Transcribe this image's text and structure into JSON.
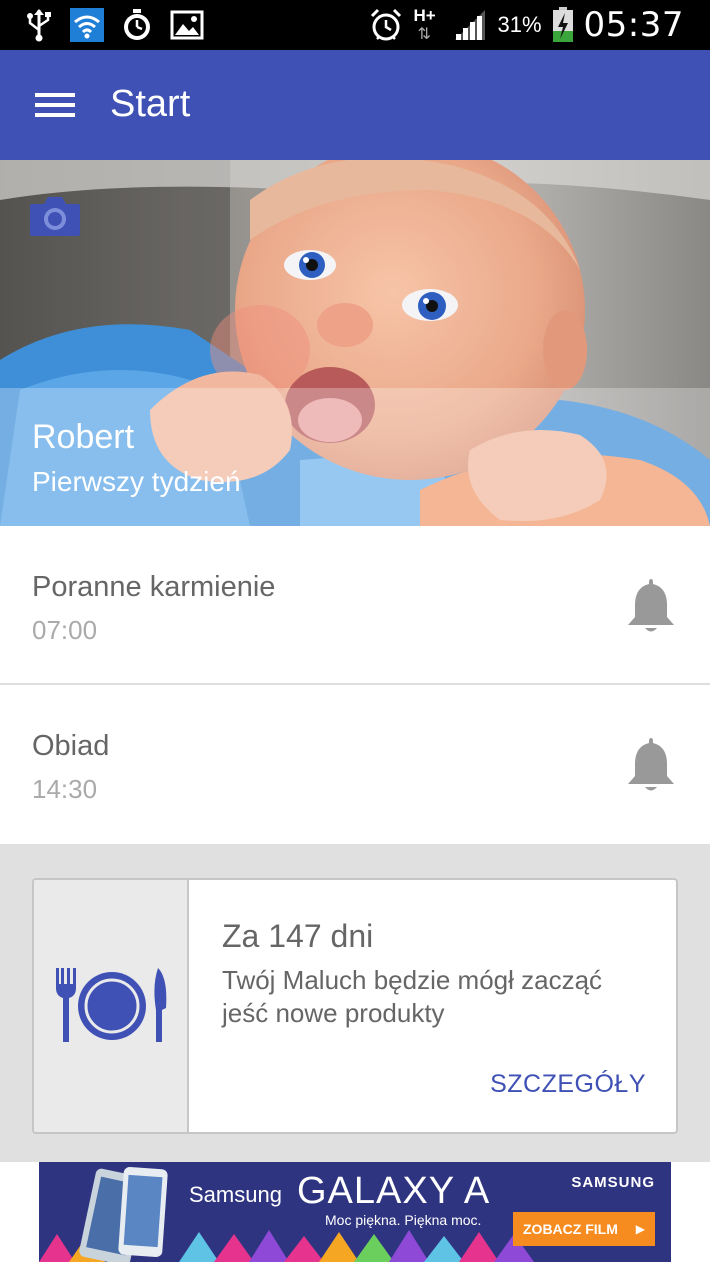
{
  "status_bar": {
    "battery_percent": "31%",
    "time": "05:37",
    "network_type": "H+"
  },
  "app_bar": {
    "title": "Start"
  },
  "hero": {
    "child_name": "Robert",
    "child_age": "Pierwszy tydzień"
  },
  "reminders": [
    {
      "title": "Poranne karmienie",
      "time": "07:00"
    },
    {
      "title": "Obiad",
      "time": "14:30"
    }
  ],
  "info_card": {
    "heading": "Za 147 dni",
    "text": "Twój Maluch będzie mógł zacząć jeść nowe produkty",
    "action": "SZCZEGÓŁY"
  },
  "ad": {
    "brand_small": "Samsung",
    "brand_big": "GALAXY A",
    "tagline": "Moc piękna. Piękna moc.",
    "logo": "SAMSUNG",
    "cta": "ZOBACZ FILM"
  },
  "colors": {
    "primary": "#3f51b5",
    "status_bar": "#000000",
    "card_bg": "#ffffff",
    "gray_area": "#e0e0e0"
  },
  "icons": [
    "usb-icon",
    "wifi-icon",
    "stopwatch-icon",
    "gallery-icon",
    "alarm-icon",
    "signal-icon",
    "battery-icon",
    "menu-icon",
    "camera-icon",
    "bell-icon",
    "cutlery-plate-icon"
  ]
}
